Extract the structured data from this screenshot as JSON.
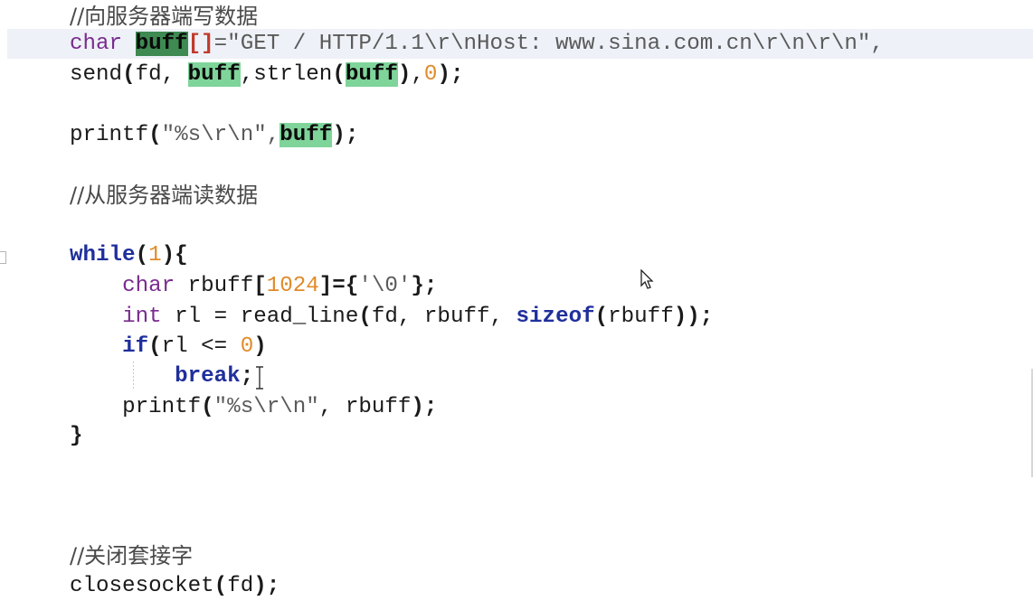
{
  "editor": {
    "lines": [
      {
        "tokens": [
          {
            "t": "//向服务器端写数据",
            "c": "cmt"
          }
        ]
      },
      {
        "tokens": [
          {
            "t": "char",
            "c": "typ"
          },
          {
            "t": " ",
            "c": ""
          },
          {
            "t": "buff",
            "c": "hl-dark"
          },
          {
            "t": "[]",
            "c": "red"
          },
          {
            "t": "=\"GET / HTTP/1.1\\r\\nHost: www.sina.com.cn\\r\\n\\r\\n\",",
            "c": "str"
          }
        ]
      },
      {
        "tokens": [
          {
            "t": "send",
            "c": "fn"
          },
          {
            "t": "(",
            "c": "paren"
          },
          {
            "t": "fd, ",
            "c": ""
          },
          {
            "t": "buff",
            "c": "hl-light"
          },
          {
            "t": ",strlen",
            "c": ""
          },
          {
            "t": "(",
            "c": "paren"
          },
          {
            "t": "buff",
            "c": "hl-light"
          },
          {
            "t": ")",
            "c": "paren"
          },
          {
            "t": ",",
            "c": ""
          },
          {
            "t": "0",
            "c": "num"
          },
          {
            "t": ");",
            "c": "paren"
          }
        ]
      },
      {
        "tokens": []
      },
      {
        "tokens": [
          {
            "t": "printf",
            "c": "fn"
          },
          {
            "t": "(",
            "c": "paren"
          },
          {
            "t": "\"%s\\r\\n\",",
            "c": "str"
          },
          {
            "t": "buff",
            "c": "hl-light"
          },
          {
            "t": ");",
            "c": "paren"
          }
        ]
      },
      {
        "tokens": []
      },
      {
        "tokens": [
          {
            "t": "//从服务器端读数据",
            "c": "cmt"
          }
        ]
      },
      {
        "tokens": []
      },
      {
        "tokens": [
          {
            "t": "while",
            "c": "kw"
          },
          {
            "t": "(",
            "c": "paren"
          },
          {
            "t": "1",
            "c": "num"
          },
          {
            "t": "){",
            "c": "paren"
          }
        ]
      },
      {
        "tokens": [
          {
            "t": "    ",
            "c": ""
          },
          {
            "t": "char",
            "c": "typ"
          },
          {
            "t": " rbuff",
            "c": ""
          },
          {
            "t": "[",
            "c": "paren"
          },
          {
            "t": "1024",
            "c": "num"
          },
          {
            "t": "]={",
            "c": "paren"
          },
          {
            "t": "'\\0'",
            "c": "str"
          },
          {
            "t": "};",
            "c": "paren"
          }
        ]
      },
      {
        "tokens": [
          {
            "t": "    ",
            "c": ""
          },
          {
            "t": "int",
            "c": "typ"
          },
          {
            "t": " rl = read_line",
            "c": ""
          },
          {
            "t": "(",
            "c": "paren"
          },
          {
            "t": "fd, rbuff, ",
            "c": ""
          },
          {
            "t": "sizeof",
            "c": "kw"
          },
          {
            "t": "(",
            "c": "paren"
          },
          {
            "t": "rbuff",
            "c": ""
          },
          {
            "t": "));",
            "c": "paren"
          }
        ]
      },
      {
        "tokens": [
          {
            "t": "    ",
            "c": ""
          },
          {
            "t": "if",
            "c": "kw"
          },
          {
            "t": "(",
            "c": "paren"
          },
          {
            "t": "rl <= ",
            "c": ""
          },
          {
            "t": "0",
            "c": "num"
          },
          {
            "t": ")",
            "c": "paren"
          }
        ]
      },
      {
        "tokens": [
          {
            "t": "        ",
            "c": ""
          },
          {
            "t": "break",
            "c": "kw"
          },
          {
            "t": ";",
            "c": "paren"
          }
        ]
      },
      {
        "tokens": [
          {
            "t": "    ",
            "c": ""
          },
          {
            "t": "printf",
            "c": "fn"
          },
          {
            "t": "(",
            "c": "paren"
          },
          {
            "t": "\"%s\\r\\n\"",
            "c": "str"
          },
          {
            "t": ", rbuff",
            "c": ""
          },
          {
            "t": ");",
            "c": "paren"
          }
        ]
      },
      {
        "tokens": [
          {
            "t": "}",
            "c": "paren"
          }
        ]
      },
      {
        "tokens": []
      },
      {
        "tokens": []
      },
      {
        "tokens": [
          {
            "t": "//关闭套接字",
            "c": "cmt"
          }
        ]
      },
      {
        "tokens": [
          {
            "t": "closesocket",
            "c": "fn"
          },
          {
            "t": "(",
            "c": "paren"
          },
          {
            "t": "fd",
            "c": ""
          },
          {
            "t": ");",
            "c": "paren"
          }
        ]
      }
    ]
  }
}
